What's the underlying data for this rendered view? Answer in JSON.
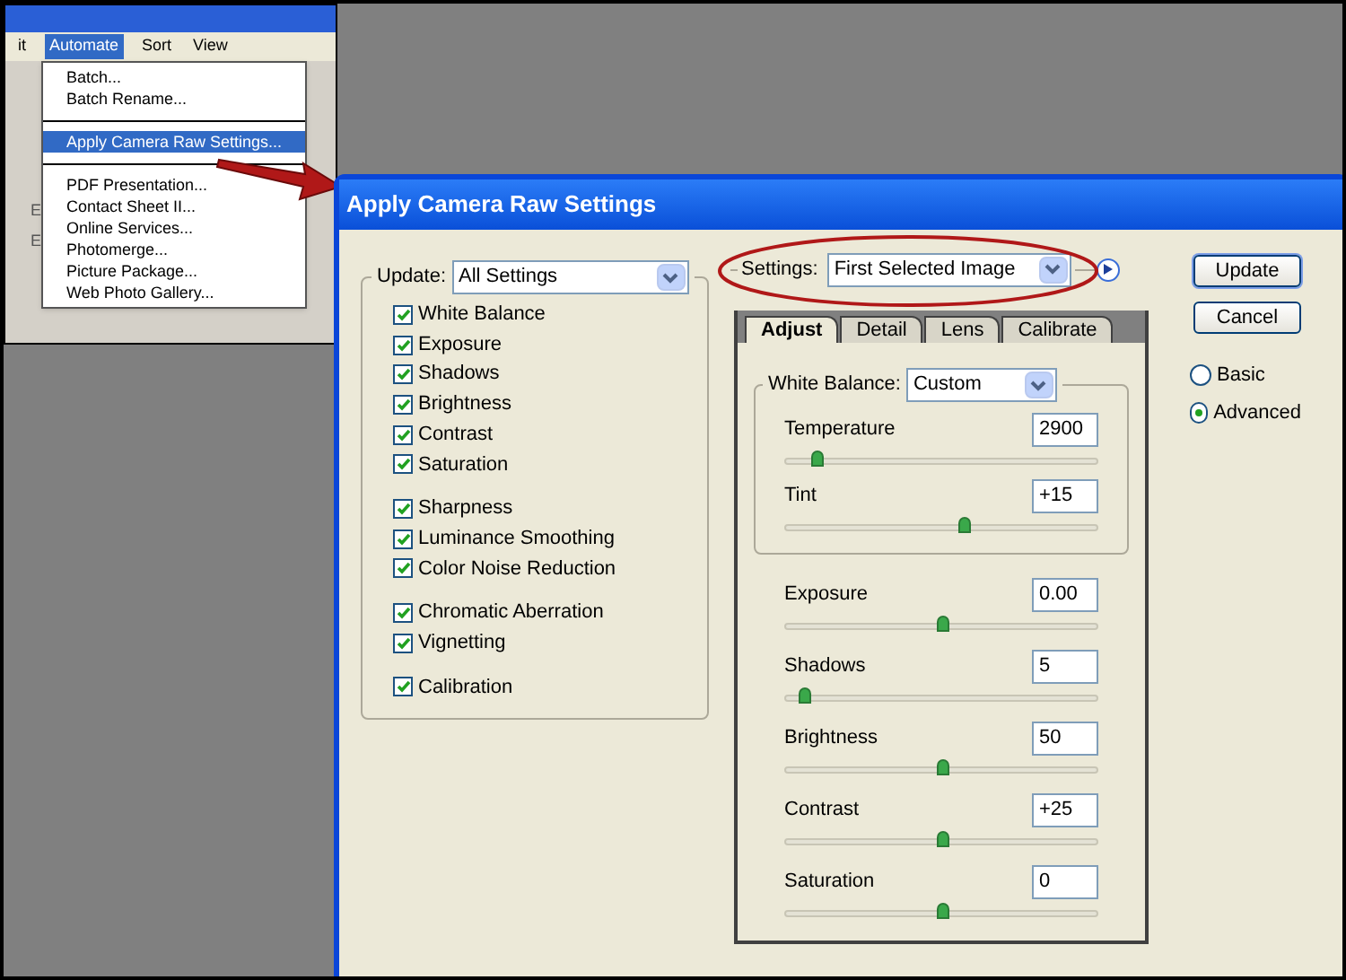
{
  "inset": {
    "menubar": [
      {
        "label": "it",
        "selected": false
      },
      {
        "label": "Automate",
        "selected": true
      },
      {
        "label": "Sort",
        "selected": false
      },
      {
        "label": "View",
        "selected": false
      }
    ],
    "menu": [
      {
        "kind": "item",
        "label": "Batch...",
        "selected": false
      },
      {
        "kind": "item",
        "label": "Batch Rename...",
        "selected": false
      },
      {
        "kind": "separator"
      },
      {
        "kind": "item",
        "label": "Apply Camera Raw Settings...",
        "selected": true
      },
      {
        "kind": "separator"
      },
      {
        "kind": "item",
        "label": "PDF Presentation...",
        "selected": false
      },
      {
        "kind": "item",
        "label": "Contact Sheet II...",
        "selected": false
      },
      {
        "kind": "item",
        "label": "Online Services...",
        "selected": false
      },
      {
        "kind": "item",
        "label": "Photomerge...",
        "selected": false
      },
      {
        "kind": "item",
        "label": "Picture Package...",
        "selected": false
      },
      {
        "kind": "item",
        "label": "Web Photo Gallery...",
        "selected": false
      }
    ],
    "background_texts": [
      "E",
      "E"
    ]
  },
  "dialog": {
    "title": "Apply Camera Raw Settings",
    "update": {
      "label": "Update:",
      "value": "All Settings"
    },
    "check_groups": [
      [
        {
          "label": "White Balance",
          "checked": true
        },
        {
          "label": "Exposure",
          "checked": true
        },
        {
          "label": "Shadows",
          "checked": true
        },
        {
          "label": "Brightness",
          "checked": true
        },
        {
          "label": "Contrast",
          "checked": true
        },
        {
          "label": "Saturation",
          "checked": true
        }
      ],
      [
        {
          "label": "Sharpness",
          "checked": true
        },
        {
          "label": "Luminance Smoothing",
          "checked": true
        },
        {
          "label": "Color Noise Reduction",
          "checked": true
        }
      ],
      [
        {
          "label": "Chromatic Aberration",
          "checked": true
        },
        {
          "label": "Vignetting",
          "checked": true
        }
      ],
      [
        {
          "label": "Calibration",
          "checked": true
        }
      ]
    ],
    "settings": {
      "label": "Settings:",
      "value": "First Selected Image"
    },
    "tabs": [
      {
        "label": "Adjust",
        "selected": true
      },
      {
        "label": "Detail",
        "selected": false
      },
      {
        "label": "Lens",
        "selected": false
      },
      {
        "label": "Calibrate",
        "selected": false
      }
    ],
    "white_balance": {
      "label": "White Balance:",
      "value": "Custom"
    },
    "white_balance_sliders": [
      {
        "name": "Temperature",
        "value": "2900",
        "level": 0.1
      },
      {
        "name": "Tint",
        "value": "+15",
        "level": 0.57
      }
    ],
    "sliders": [
      {
        "name": "Exposure",
        "value": "0.00",
        "level": 0.5
      },
      {
        "name": "Shadows",
        "value": "5",
        "level": 0.06
      },
      {
        "name": "Brightness",
        "value": "50",
        "level": 0.5
      },
      {
        "name": "Contrast",
        "value": "+25",
        "level": 0.5
      },
      {
        "name": "Saturation",
        "value": "0",
        "level": 0.5
      }
    ],
    "buttons": [
      "Update",
      "Cancel"
    ],
    "modes": [
      {
        "label": "Basic",
        "selected": false
      },
      {
        "label": "Advanced",
        "selected": true
      }
    ]
  }
}
